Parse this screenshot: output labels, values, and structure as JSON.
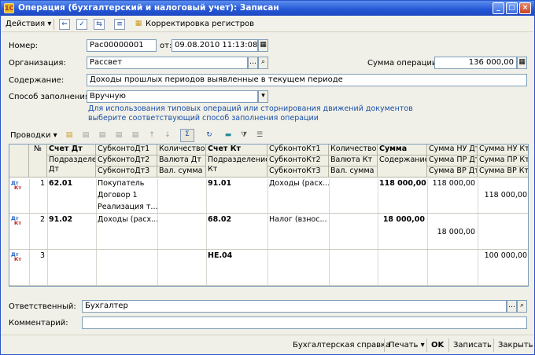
{
  "window": {
    "title": "Операция (бухгалтерский и налоговый учет): Записан",
    "title_buttons": [
      "_",
      "□",
      "×"
    ]
  },
  "toolbar": {
    "actions_label": "Действия",
    "registers_label": "Корректировка регистров"
  },
  "form": {
    "number_label": "Номер:",
    "number_value": "Рас00000001",
    "date_label": "от:",
    "date_value": "09.08.2010 11:13:08",
    "org_label": "Организация:",
    "org_value": "Рассвет",
    "sum_label": "Сумма операции:",
    "sum_value": "136 000,00",
    "content_label": "Содержание:",
    "content_value": "Доходы прошлых периодов выявленные в текущем периоде",
    "fill_label": "Способ заполнения:",
    "fill_value": "Вручную",
    "hint_line1": "Для использования типовых операций или сторнирования движений документов",
    "hint_line2": "выберите соответствующий способ заполнения операции"
  },
  "postings": {
    "label": "Проводки"
  },
  "table": {
    "headers": {
      "n": "№",
      "dt": [
        "Счет Дт",
        "Подразделение Дт"
      ],
      "subdt": [
        "СубконтоДт1",
        "СубконтоДт2",
        "СубконтоДт3"
      ],
      "qtydt": [
        "Количество Дт",
        "Валюта Дт",
        "Вал. сумма Дт"
      ],
      "kt": [
        "Счет Кт",
        "Подразделение Кт"
      ],
      "subkt": [
        "СубконтоКт1",
        "СубконтоКт2",
        "СубконтоКт3"
      ],
      "qtykt": [
        "Количество Кт",
        "Валюта Кт",
        "Вал. сумма Кт"
      ],
      "sum": [
        "Сумма",
        "Содержание"
      ],
      "nu_dt": [
        "Сумма НУ Дт",
        "Сумма ПР Дт",
        "Сумма ВР Дт"
      ],
      "nu_kt": [
        "Сумма НУ Кт",
        "Сумма ПР Кт",
        "Сумма ВР Кт"
      ]
    },
    "rows": [
      {
        "n": "1",
        "dt": "62.01",
        "subdt": [
          "Покупатель",
          "Договор 1",
          "Реализация т..."
        ],
        "kt": "91.01",
        "subkt": "Доходы (расх...",
        "sum": "118 000,00",
        "nu_dt": "118 000,00",
        "nu_kt": "118 000,00"
      },
      {
        "n": "2",
        "dt": "91.02",
        "subdt": [
          "Доходы (расх..."
        ],
        "kt": "68.02",
        "subkt": "Налог (взнос...",
        "sum": "18 000,00",
        "nu_dt": "18 000,00",
        "nu_kt": ""
      },
      {
        "n": "3",
        "dt": "",
        "subdt": [],
        "kt": "НЕ.04",
        "subkt": "",
        "sum": "",
        "nu_dt": "",
        "nu_kt": "100 000,00"
      }
    ],
    "dt_mark": "Дт",
    "kt_mark": "Кт"
  },
  "footer": {
    "responsible_label": "Ответственный:",
    "responsible_value": "Бухгалтер",
    "comment_label": "Комментарий:",
    "comment_value": ""
  },
  "bottom": {
    "report": "Бухгалтерская справка",
    "print": "Печать",
    "ok": "OK",
    "save": "Записать",
    "close": "Закрыть"
  }
}
